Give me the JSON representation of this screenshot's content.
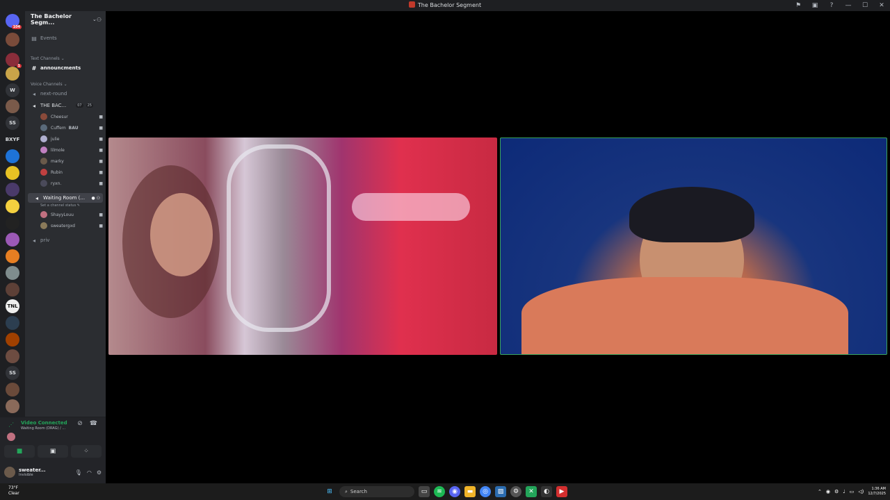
{
  "window": {
    "title": "The Bachelor Segment"
  },
  "servers": [
    {
      "label": "",
      "color": "#5865f2",
      "badge": "104"
    },
    {
      "label": "",
      "color": "#7a4b3a",
      "badge": ""
    },
    {
      "label": "",
      "color": "#8a2d3a",
      "badge": "1"
    },
    {
      "label": "",
      "color": "#c9a449",
      "badge": ""
    },
    {
      "label": "W",
      "color": "#313338",
      "badge": ""
    },
    {
      "label": "",
      "color": "#7a5a4a",
      "badge": ""
    },
    {
      "label": "SS",
      "color": "#313338",
      "badge": ""
    },
    {
      "label": "BXYF",
      "color": "#1e1f22",
      "badge": ""
    },
    {
      "label": "",
      "color": "#1e73d8",
      "badge": ""
    },
    {
      "label": "",
      "color": "#e8c224",
      "badge": ""
    },
    {
      "label": "",
      "color": "#4a3a6a",
      "badge": ""
    },
    {
      "label": "",
      "color": "#f4d03f",
      "badge": ""
    },
    {
      "label": "",
      "color": "#222",
      "badge": ""
    },
    {
      "label": "",
      "color": "#9b59b6",
      "badge": ""
    },
    {
      "label": "",
      "color": "#e67e22",
      "badge": ""
    },
    {
      "label": "",
      "color": "#7f8c8d",
      "badge": ""
    },
    {
      "label": "",
      "color": "#5d4037",
      "badge": ""
    },
    {
      "label": "TNL",
      "color": "#eeeeee",
      "badge": ""
    },
    {
      "label": "",
      "color": "#2c3e50",
      "badge": ""
    },
    {
      "label": "",
      "color": "#a04000",
      "badge": ""
    },
    {
      "label": "",
      "color": "#6d4c41",
      "badge": ""
    },
    {
      "label": "SS",
      "color": "#313338",
      "badge": ""
    },
    {
      "label": "",
      "color": "#6a4a3a",
      "badge": ""
    },
    {
      "label": "",
      "color": "#8a6a5a",
      "badge": ""
    }
  ],
  "guild": {
    "name": "The Bachelor Segm..."
  },
  "channels": {
    "events": "Events",
    "text_category": "Text Channels",
    "announcements": "announcments",
    "voice_category": "Voice Channels",
    "next_round": "next-round",
    "bachelor_voice": "THE BAC...",
    "bachelor_pill_1": "07",
    "bachelor_pill_2": "25",
    "waiting_room": "Waiting Room (...",
    "waiting_status": "Set a channel status",
    "priv": "priv"
  },
  "bachelor_users": [
    {
      "name": "Cheesur",
      "tag": "",
      "color": "#8a4a3a"
    },
    {
      "name": "Cuffem",
      "tag": "BAU",
      "color": "#5a6a7a"
    },
    {
      "name": "julie",
      "tag": "",
      "color": "#b0b0d0"
    },
    {
      "name": "lilmole",
      "tag": "",
      "color": "#c080c0"
    },
    {
      "name": "marky",
      "tag": "",
      "color": "#6a5a4a"
    },
    {
      "name": "Rubin",
      "tag": "",
      "color": "#c04040"
    },
    {
      "name": "ryxn.",
      "tag": "",
      "color": "#4a4a5a"
    }
  ],
  "waiting_users": [
    {
      "name": "ShayyLouu",
      "tag": "",
      "color": "#c07080"
    },
    {
      "name": "sweatergxd",
      "tag": "",
      "color": "#8a7a5a"
    }
  ],
  "voice_panel": {
    "status": "Video Connected",
    "channel": "Waiting Room (DRAG) / ..."
  },
  "user": {
    "name": "sweater...",
    "status": "Invisible"
  },
  "taskbar": {
    "temp": "73°F",
    "weather": "Clear",
    "search": "Search",
    "time": "1:36 AM",
    "date": "12/7/2025"
  }
}
